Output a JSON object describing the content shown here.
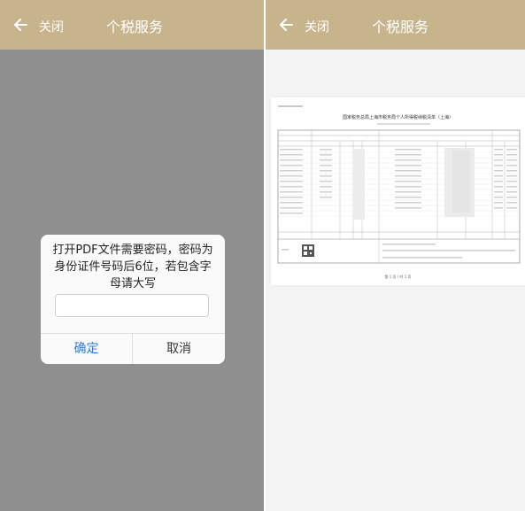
{
  "left": {
    "topbar": {
      "close_label": "关闭",
      "title": "个税服务"
    },
    "dialog": {
      "message": "打开PDF文件需要密码，密码为身份证件号码后6位，若包含字母请大写",
      "input_value": "",
      "confirm_label": "确定",
      "cancel_label": "取消"
    }
  },
  "right": {
    "topbar": {
      "close_label": "关闭",
      "title": "个税服务"
    },
    "document": {
      "title": "国家税务总局上海市税务局个人所得税纳税清单（上海）",
      "page_indicator": "第 1 页 / 共 1 页"
    }
  },
  "colors": {
    "topbar": "#c8b48c",
    "overlay": "#8e8f8e",
    "link_blue": "#2f7bd6"
  }
}
